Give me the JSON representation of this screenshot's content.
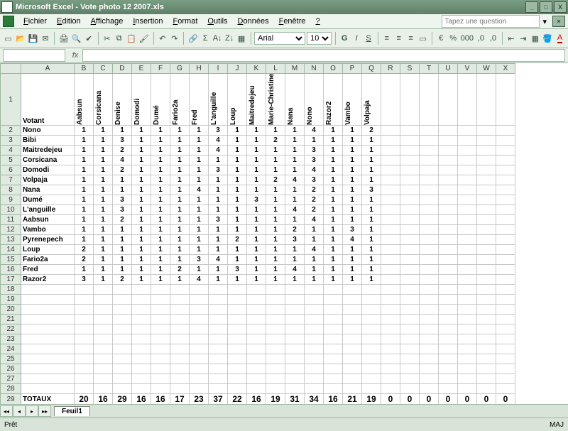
{
  "title": "Microsoft Excel - Vote photo 12 2007.xls",
  "menus": [
    "Fichier",
    "Edition",
    "Affichage",
    "Insertion",
    "Format",
    "Outils",
    "Données",
    "Fenêtre",
    "?"
  ],
  "askPlaceholder": "Tapez une question",
  "font": {
    "name": "Arial",
    "size": "10"
  },
  "sheetTab": "Feuil1",
  "status": {
    "ready": "Prêt",
    "caps": "MAJ"
  },
  "colLetters": [
    "A",
    "B",
    "C",
    "D",
    "E",
    "F",
    "G",
    "H",
    "I",
    "J",
    "K",
    "L",
    "M",
    "N",
    "O",
    "P",
    "Q",
    "R",
    "S",
    "T",
    "U",
    "V",
    "W",
    "X"
  ],
  "headerFirst": "Votant",
  "voterHeads": [
    "Aabsun",
    "Corsicana",
    "Denise",
    "Domodi",
    "Dumé",
    "Fario2a",
    "Fred",
    "L'anguille",
    "Loup",
    "Maitredejeu",
    "Marie-Christine",
    "Nana",
    "Nono",
    "Razor2",
    "Vambo",
    "Volpaja"
  ],
  "rows": [
    {
      "n": "Nono",
      "v": [
        1,
        1,
        1,
        1,
        1,
        1,
        1,
        3,
        1,
        1,
        1,
        1,
        4,
        1,
        1,
        2
      ]
    },
    {
      "n": "Bibi",
      "v": [
        1,
        1,
        3,
        1,
        1,
        1,
        1,
        4,
        1,
        1,
        2,
        1,
        1,
        1,
        1,
        1
      ]
    },
    {
      "n": "Maitredejeu",
      "v": [
        1,
        1,
        2,
        1,
        1,
        1,
        1,
        4,
        1,
        1,
        1,
        1,
        3,
        1,
        1,
        1
      ]
    },
    {
      "n": "Corsicana",
      "v": [
        1,
        1,
        4,
        1,
        1,
        1,
        1,
        1,
        1,
        1,
        1,
        1,
        3,
        1,
        1,
        1
      ]
    },
    {
      "n": "Domodi",
      "v": [
        1,
        1,
        2,
        1,
        1,
        1,
        1,
        3,
        1,
        1,
        1,
        1,
        4,
        1,
        1,
        1
      ]
    },
    {
      "n": "Volpaja",
      "v": [
        1,
        1,
        1,
        1,
        1,
        1,
        1,
        1,
        1,
        1,
        2,
        4,
        3,
        1,
        1,
        1
      ]
    },
    {
      "n": "Nana",
      "v": [
        1,
        1,
        1,
        1,
        1,
        1,
        4,
        1,
        1,
        1,
        1,
        1,
        2,
        1,
        1,
        3
      ]
    },
    {
      "n": "Dumé",
      "v": [
        1,
        1,
        3,
        1,
        1,
        1,
        1,
        1,
        1,
        3,
        1,
        1,
        2,
        1,
        1,
        1
      ]
    },
    {
      "n": "L'anguille",
      "v": [
        1,
        1,
        3,
        1,
        1,
        1,
        1,
        1,
        1,
        1,
        1,
        4,
        2,
        1,
        1,
        1
      ]
    },
    {
      "n": "Aabsun",
      "v": [
        1,
        1,
        2,
        1,
        1,
        1,
        1,
        3,
        1,
        1,
        1,
        1,
        4,
        1,
        1,
        1
      ]
    },
    {
      "n": "Vambo",
      "v": [
        1,
        1,
        1,
        1,
        1,
        1,
        1,
        1,
        1,
        1,
        1,
        2,
        1,
        1,
        3,
        1
      ]
    },
    {
      "n": "Pyrenepech",
      "v": [
        1,
        1,
        1,
        1,
        1,
        1,
        1,
        1,
        2,
        1,
        1,
        3,
        1,
        1,
        4,
        1
      ]
    },
    {
      "n": "Loup",
      "v": [
        2,
        1,
        1,
        1,
        1,
        1,
        1,
        1,
        1,
        1,
        1,
        1,
        4,
        1,
        1,
        1
      ]
    },
    {
      "n": "Fario2a",
      "v": [
        2,
        1,
        1,
        1,
        1,
        1,
        3,
        4,
        1,
        1,
        1,
        1,
        1,
        1,
        1,
        1
      ]
    },
    {
      "n": "Fred",
      "v": [
        1,
        1,
        1,
        1,
        1,
        2,
        1,
        1,
        3,
        1,
        1,
        4,
        1,
        1,
        1,
        1
      ]
    },
    {
      "n": "Razor2",
      "v": [
        3,
        1,
        2,
        1,
        1,
        1,
        4,
        1,
        1,
        1,
        1,
        1,
        1,
        1,
        1,
        1
      ]
    }
  ],
  "totalsLabel": "TOTAUX",
  "totals": [
    20,
    16,
    29,
    16,
    16,
    17,
    23,
    37,
    22,
    16,
    19,
    31,
    34,
    16,
    21,
    19,
    0,
    0,
    0,
    0,
    0,
    0,
    0
  ]
}
